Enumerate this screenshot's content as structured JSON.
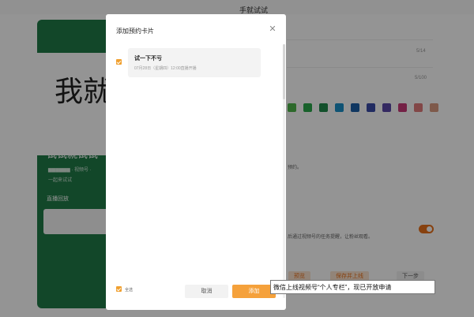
{
  "background": {
    "top_title": "手就试试",
    "cover_big_text": "我就",
    "cover_title": "试试就试试",
    "cover_meta": "▆▆▆▆▆▆ · 视频号 ·",
    "cover_sub": "一起来试试",
    "cover_label": "直播回放",
    "count_1": "5/14",
    "count_2": "5/100",
    "small_text_1": "预约。",
    "small_text_2": "后通过视频号的任务提醒，让粉丝观看。",
    "bottom_btn_1": "预览",
    "bottom_btn_2": "保存并上线",
    "bottom_btn_3": "下一步",
    "swatches": [
      "#4fb64a",
      "#2aa84a",
      "#1f8a4a",
      "#1a90c8",
      "#1d5fa8",
      "#3a4aa8",
      "#5a48a8",
      "#c83a78",
      "#e07a7a",
      "#d99a80"
    ],
    "accent": "#e8701a",
    "cover_color": "#1f7a47"
  },
  "dialog": {
    "title": "添加预约卡片",
    "close_icon": "close-icon",
    "items": [
      {
        "title": "试一下不亏",
        "subtitle": "07月28日（星期四）12:00直播开播",
        "checked": true
      }
    ],
    "select_all_label": "全选",
    "select_all_checked": true,
    "cancel_label": "取消",
    "add_label": "添加",
    "accent": "#f5a13b"
  },
  "tooltip": {
    "text": "微信上线视频号“个人专栏”，现已开放申请"
  }
}
